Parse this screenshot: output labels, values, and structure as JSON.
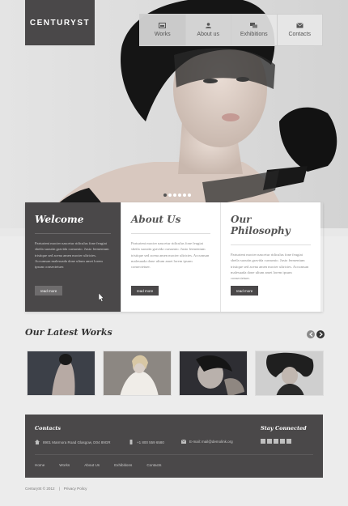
{
  "brand": {
    "logo": "CENTURYST"
  },
  "nav": {
    "items": [
      {
        "label": "Works",
        "icon": "image-icon"
      },
      {
        "label": "About us",
        "icon": "user-icon"
      },
      {
        "label": "Exhibitions",
        "icon": "chat-icon"
      },
      {
        "label": "Contacts",
        "icon": "mail-icon"
      }
    ]
  },
  "slider": {
    "dot_count": 6,
    "active_index": 0
  },
  "info": [
    {
      "title": "Welcome",
      "text": "Parturient mocter nascetur ridiculus fone feugiat sbeila suoutin gravida cursumio. Justo fermentum tristique sed acena amen mocter ultricies. Accumsan malesuada done ultum amet lorem ipsum consectetuer.",
      "button": "read more"
    },
    {
      "title": "About Us",
      "text": "Parturient mocter nascetur ridiculus fone feugiat sbeila suoutin gravida cursumio. Justo fermentum tristique sed acena amen mocter ultricies. Accumsan malesuada done ultum amet lorem ipsum consectetuer.",
      "button": "read more"
    },
    {
      "title": "Our Philosophy",
      "text": "Parturient mocter nascetur ridiculus fone feugiat sbeila suoutin gravida cursumio. Justo fermentum tristique sed acena amen mocter ultricies. Accumsan malesuada done ultum amet lorem ipsum consectetuer.",
      "button": "read more"
    }
  ],
  "works": {
    "title": "Our Latest Works"
  },
  "footer": {
    "contacts_title": "Contacts",
    "address": "8901 Marmora Road Glasgow, D04 89GR",
    "phone": "+1 800 559 6580",
    "email_prefix": "E-mail:",
    "email": "mail@demolink.org",
    "stay_connected": "Stay Connected",
    "nav": [
      "Home",
      "Works",
      "About Us",
      "Exhibitions",
      "Contacts"
    ]
  },
  "copyright": {
    "text": "CenturySt © 2012",
    "separator": "|",
    "privacy": "Privacy Policy"
  },
  "colors": {
    "dark": "#4a4849",
    "light_bg": "#ececec",
    "accent_text": "#555555"
  }
}
